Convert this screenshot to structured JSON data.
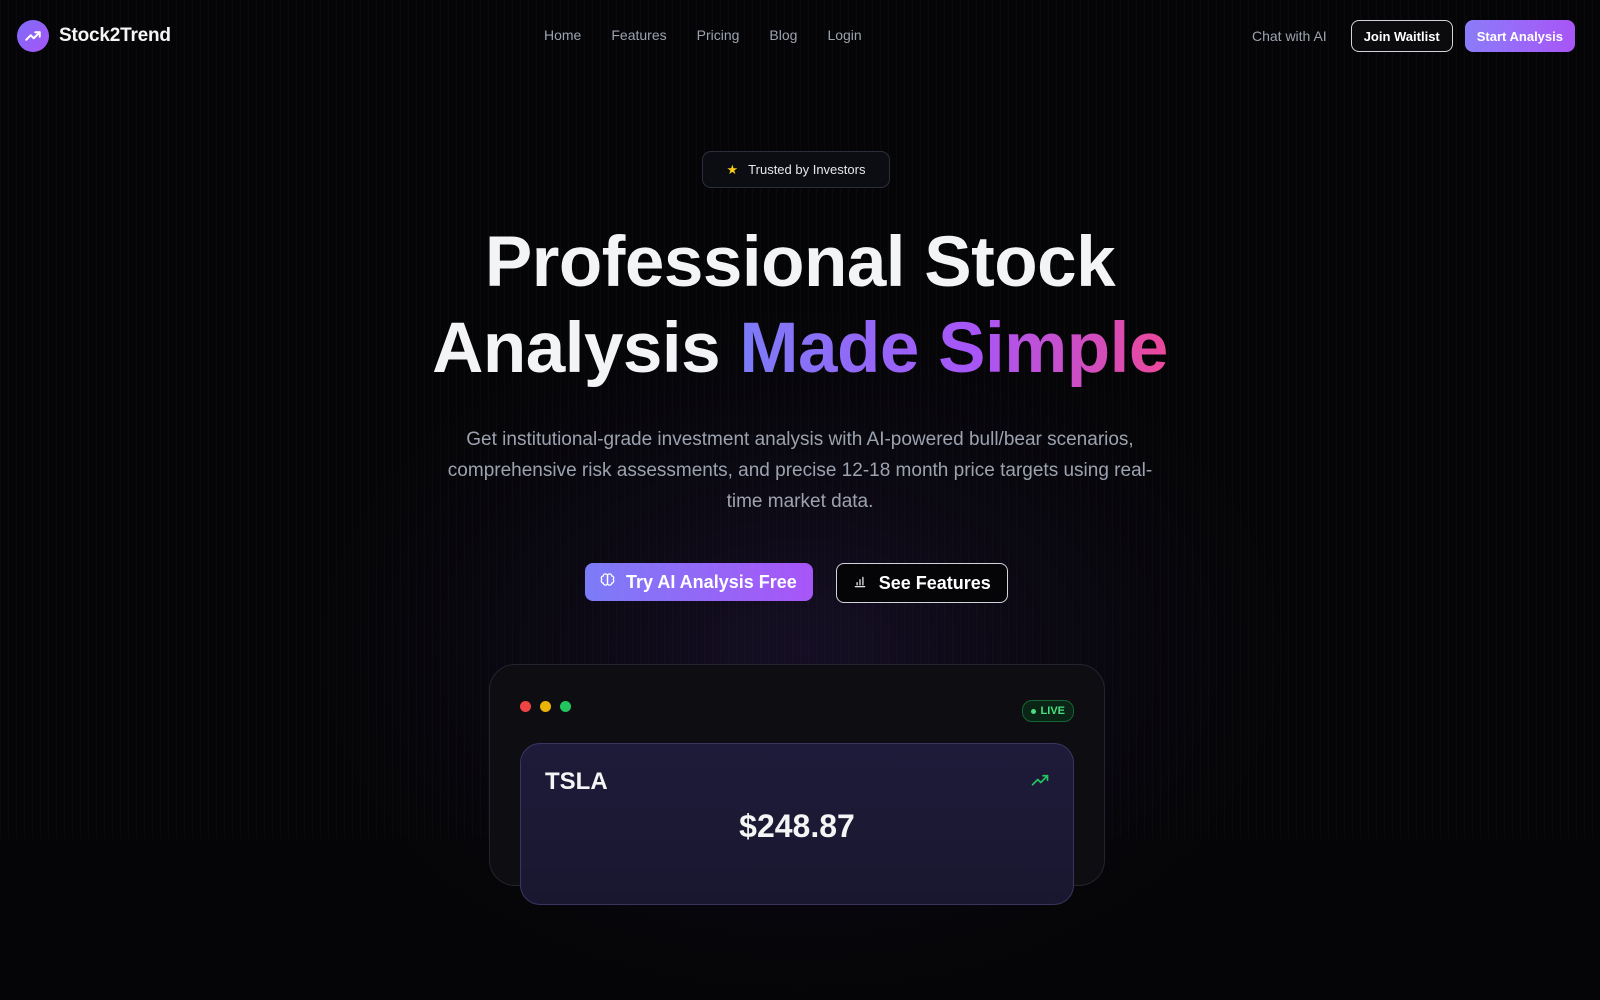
{
  "brand": {
    "name": "Stock2Trend",
    "logo_icon": "trending-up-icon",
    "accent": "#8b7cf8"
  },
  "nav": {
    "links": [
      "Home",
      "Features",
      "Pricing",
      "Blog",
      "Login"
    ],
    "chat_label": "Chat with AI",
    "waitlist_label": "Join Waitlist",
    "start_label": "Start Analysis"
  },
  "hero": {
    "badge_icon": "star-icon",
    "badge_text": "Trusted by Investors",
    "headline_line1": "Professional Stock",
    "headline_line2_plain": "Analysis",
    "headline_line2_gradient": "Made Simple",
    "subtext": "Get institutional-grade investment analysis with AI-powered bull/bear scenarios, comprehensive risk assessments, and precise 12-18 month price targets using real-time market data.",
    "cta_primary_icon": "brain-icon",
    "cta_primary": "Try AI Analysis Free",
    "cta_secondary_icon": "bar-chart-icon",
    "cta_secondary": "See Features"
  },
  "preview": {
    "window_dots": [
      "#ef4444",
      "#eab308",
      "#22c55e"
    ],
    "live_label": "LIVE",
    "ticker": "TSLA",
    "trend_icon": "trending-up-icon",
    "price": "$248.87"
  }
}
